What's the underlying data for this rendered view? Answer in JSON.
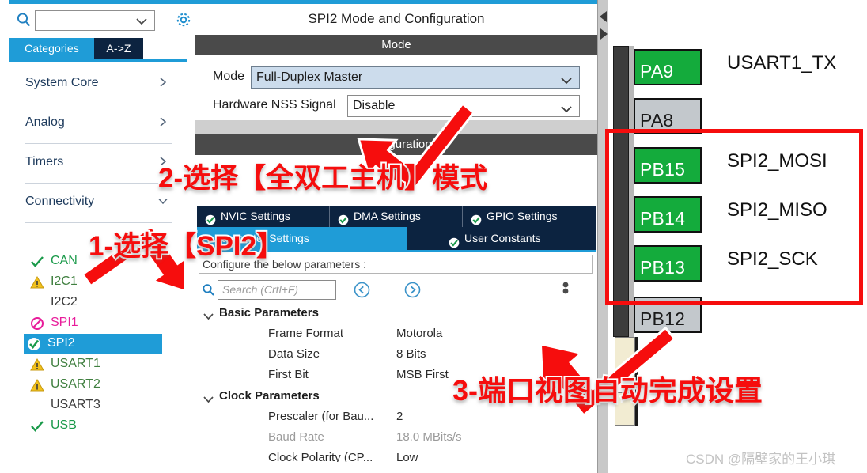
{
  "sidebar": {
    "search": {
      "value": "",
      "placeholder": ""
    },
    "gear_icon": "gear-icon",
    "search_icon": "search-icon",
    "tabs": [
      {
        "label": "Categories",
        "active": true
      },
      {
        "label": "A->Z",
        "active": false
      }
    ],
    "categories": [
      {
        "label": "System Core",
        "arrow": "chevron-right-icon"
      },
      {
        "label": "Analog",
        "arrow": "chevron-right-icon"
      },
      {
        "label": "Timers",
        "arrow": "chevron-right-icon"
      },
      {
        "label": "Connectivity",
        "arrow": "chevron-down-icon"
      }
    ],
    "peripherals": [
      {
        "label": "CAN",
        "icon": "check-icon",
        "state": "ok"
      },
      {
        "label": "I2C1",
        "icon": "warning-icon",
        "state": "warn"
      },
      {
        "label": "I2C2",
        "icon": "none",
        "state": "none"
      },
      {
        "label": "SPI1",
        "icon": "forbidden-icon",
        "state": "error"
      },
      {
        "label": "SPI2",
        "icon": "check-circle-icon",
        "state": "ok",
        "selected": true
      },
      {
        "label": "USART1",
        "icon": "warning-icon",
        "state": "warn"
      },
      {
        "label": "USART2",
        "icon": "warning-icon",
        "state": "warn"
      },
      {
        "label": "USART3",
        "icon": "none",
        "state": "none"
      },
      {
        "label": "USB",
        "icon": "check-icon",
        "state": "ok"
      }
    ]
  },
  "center": {
    "title": "SPI2 Mode and Configuration",
    "mode_section_title": "Mode",
    "config_section_title": "Configuration",
    "fields": [
      {
        "label": "Mode",
        "value": "Full-Duplex Master",
        "highlight": true
      },
      {
        "label": "Hardware NSS Signal",
        "value": "Disable",
        "highlight": false
      }
    ],
    "tabs_top": [
      {
        "label": "NVIC Settings",
        "icon": "check-circle-icon",
        "active": false
      },
      {
        "label": "DMA Settings",
        "icon": "check-circle-icon",
        "active": false
      },
      {
        "label": "GPIO Settings",
        "icon": "check-circle-icon",
        "active": false
      }
    ],
    "tabs_bottom": [
      {
        "label": "Parameter Settings",
        "icon": "check-circle-icon",
        "active": true
      },
      {
        "label": "User Constants",
        "icon": "check-circle-icon",
        "active": false
      }
    ],
    "config_note": "Configure the below parameters :",
    "param_search": {
      "placeholder": "Search (Crtl+F)",
      "value": ""
    },
    "nav_prev_icon": "circle-left-arrow-icon",
    "nav_next_icon": "circle-right-arrow-icon",
    "more_icon": "more-vertical-icon",
    "param_groups": [
      {
        "name": "Basic Parameters",
        "chevron": "chevron-down-icon",
        "rows": [
          {
            "name": "Frame Format",
            "value": "Motorola",
            "dim": false
          },
          {
            "name": "Data Size",
            "value": "8 Bits",
            "dim": false
          },
          {
            "name": "First Bit",
            "value": "MSB First",
            "dim": false
          }
        ]
      },
      {
        "name": "Clock Parameters",
        "chevron": "chevron-down-icon",
        "rows": [
          {
            "name": "Prescaler (for Bau...",
            "value": "2",
            "dim": false
          },
          {
            "name": "Baud Rate",
            "value": "18.0 MBits/s",
            "dim": true
          },
          {
            "name": "Clock Polarity (CP...",
            "value": "Low",
            "dim": false
          }
        ]
      }
    ]
  },
  "divider": {
    "collapse_left_icon": "triangle-left-icon",
    "collapse_right_icon": "triangle-right-icon"
  },
  "pinview": {
    "pins": [
      {
        "name": "PA9",
        "signal": "USART1_TX",
        "active": true
      },
      {
        "name": "PA8",
        "signal": "",
        "active": false
      },
      {
        "name": "PB15",
        "signal": "SPI2_MOSI",
        "active": true
      },
      {
        "name": "PB14",
        "signal": "SPI2_MISO",
        "active": true
      },
      {
        "name": "PB13",
        "signal": "SPI2_SCK",
        "active": true
      },
      {
        "name": "PB12",
        "signal": "",
        "active": false
      }
    ],
    "highlight_color": "#f60d0d",
    "active_color": "#14ab3c",
    "inactive_color": "#c3c8cc",
    "watermark": "CSDN @隔壁家的王小琪"
  },
  "annotations": [
    {
      "id": "1",
      "text": "1-选择【SPI2】",
      "color": "#f60d0d"
    },
    {
      "id": "2",
      "text": "2-选择【全双工主机】模式",
      "color": "#f60d0d"
    },
    {
      "id": "3",
      "text": "3-端口视图自动完成设置",
      "color": "#f60d0d"
    }
  ]
}
